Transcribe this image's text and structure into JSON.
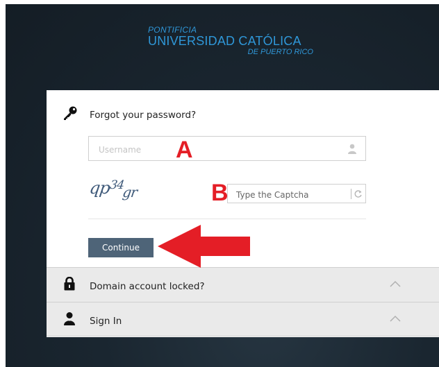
{
  "header": {
    "logo_line1": "PONTIFICIA",
    "logo_line2": "UNIVERSIDAD CATÓLICA",
    "logo_line3": "DE PUERTO RICO"
  },
  "forgot": {
    "title": "Forgot your password?",
    "username_placeholder": "Username",
    "username_value": "",
    "captcha_text": "qp34gr",
    "captcha_placeholder": "Type the Captcha",
    "captcha_value": "",
    "continue_label": "Continue"
  },
  "sections": [
    {
      "label": "Domain account locked?",
      "icon": "lock-icon",
      "state": "collapsed"
    },
    {
      "label": "Sign In",
      "icon": "user-icon",
      "state": "collapsed"
    }
  ],
  "annotations": {
    "a": "A",
    "b": "B"
  },
  "colors": {
    "background": "#18222b",
    "logo_blue": "#2f97d8",
    "button": "#4e6478",
    "annotation_red": "#e41e26",
    "accordion_bg": "#eaeaea"
  }
}
